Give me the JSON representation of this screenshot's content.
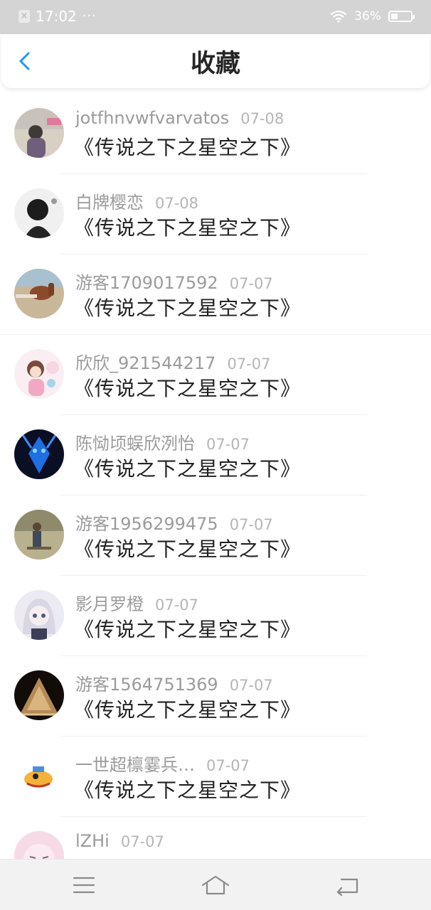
{
  "status_bar": {
    "time": "17:02",
    "dots": "···",
    "battery_percent": "36%",
    "battery_level": 0.36,
    "icons": [
      "notification-dismissed-icon",
      "wifi-icon",
      "battery-icon"
    ]
  },
  "header": {
    "title": "收藏",
    "back_icon": "chevron-left-icon",
    "accent_color": "#2196f3"
  },
  "favorites": [
    {
      "username": "jotfhnvwfvarvatos",
      "date": "07-08",
      "title": "《传说之下之星空之下》"
    },
    {
      "username": "白牌樱恋",
      "date": "07-08",
      "title": "《传说之下之星空之下》"
    },
    {
      "username": "游客1709017592",
      "date": "07-07",
      "title": "《传说之下之星空之下》"
    },
    {
      "username": "欣欣_921544217",
      "date": "07-07",
      "title": "《传说之下之星空之下》"
    },
    {
      "username": "陈恸顷蜈欣洌怡",
      "date": "07-07",
      "title": "《传说之下之星空之下》"
    },
    {
      "username": "游客1956299475",
      "date": "07-07",
      "title": "《传说之下之星空之下》"
    },
    {
      "username": "影月罗橙",
      "date": "07-07",
      "title": "《传说之下之星空之下》"
    },
    {
      "username": "游客1564751369",
      "date": "07-07",
      "title": "《传说之下之星空之下》"
    },
    {
      "username": "一世超檩霎兵…",
      "date": "07-07",
      "title": "《传说之下之星空之下》"
    },
    {
      "username": "lZHi",
      "date": "07-07",
      "title": ""
    }
  ],
  "bottom_nav": {
    "icons": [
      "menu-icon",
      "home-icon",
      "back-icon"
    ]
  }
}
